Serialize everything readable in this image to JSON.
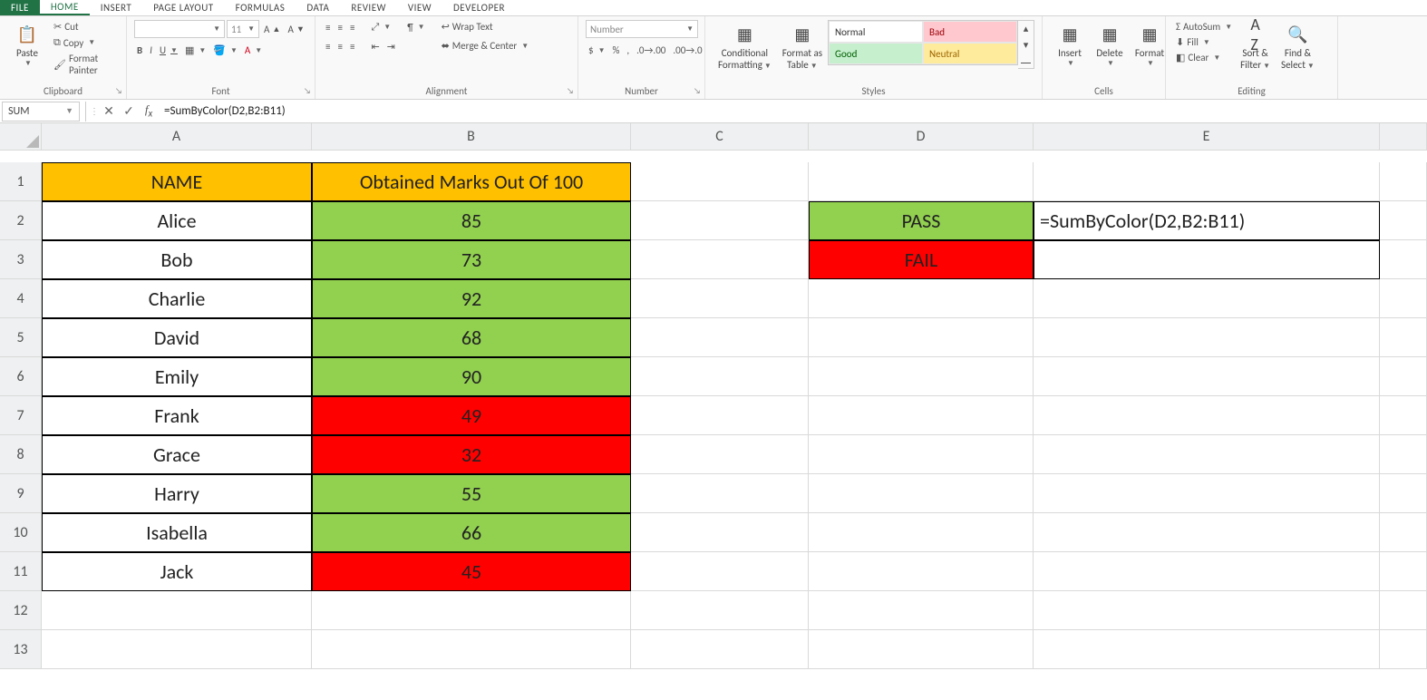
{
  "tabs": {
    "file": "FILE",
    "home": "HOME",
    "insert": "INSERT",
    "page_layout": "PAGE LAYOUT",
    "formulas": "FORMULAS",
    "data": "DATA",
    "review": "REVIEW",
    "view": "VIEW",
    "developer": "DEVELOPER"
  },
  "clipboard": {
    "paste": "Paste",
    "cut": "Cut",
    "copy": "Copy",
    "format_painter": "Format Painter",
    "label": "Clipboard"
  },
  "font": {
    "size": "11",
    "bold": "B",
    "italic": "I",
    "underline": "U",
    "label": "Font"
  },
  "alignment": {
    "wrap": "Wrap Text",
    "merge": "Merge & Center",
    "label": "Alignment"
  },
  "number": {
    "format": "Number",
    "label": "Number"
  },
  "styles": {
    "cond": "Conditional",
    "cond2": "Formatting",
    "fmt_table": "Format as",
    "fmt_table2": "Table",
    "normal": "Normal",
    "bad": "Bad",
    "good": "Good",
    "neutral": "Neutral",
    "label": "Styles"
  },
  "cells": {
    "insert": "Insert",
    "delete": "Delete",
    "format": "Format",
    "label": "Cells"
  },
  "editing": {
    "autosum": "AutoSum",
    "fill": "Fill",
    "clear": "Clear",
    "sort": "Sort &",
    "sort2": "Filter",
    "find": "Find &",
    "find2": "Select",
    "label": "Editing"
  },
  "name_box": "SUM",
  "formula": "=SumByColor(D2,B2:B11)",
  "cols": [
    "A",
    "B",
    "C",
    "D",
    "E"
  ],
  "rows": [
    "1",
    "2",
    "3",
    "4",
    "5",
    "6",
    "7",
    "8",
    "9",
    "10",
    "11",
    "12",
    "13"
  ],
  "headers": {
    "name": "NAME",
    "marks": "Obtained Marks Out Of 100"
  },
  "students": [
    {
      "name": "Alice",
      "mark": "85",
      "color": "green"
    },
    {
      "name": "Bob",
      "mark": "73",
      "color": "green"
    },
    {
      "name": "Charlie",
      "mark": "92",
      "color": "green"
    },
    {
      "name": "David",
      "mark": "68",
      "color": "green"
    },
    {
      "name": "Emily",
      "mark": "90",
      "color": "green"
    },
    {
      "name": "Frank",
      "mark": "49",
      "color": "red"
    },
    {
      "name": "Grace",
      "mark": "32",
      "color": "red"
    },
    {
      "name": "Harry",
      "mark": "55",
      "color": "green"
    },
    {
      "name": "Isabella",
      "mark": "66",
      "color": "green"
    },
    {
      "name": "Jack",
      "mark": "45",
      "color": "red"
    }
  ],
  "d2": "PASS",
  "d3": "FAIL",
  "e2": "=SumByColor(D2,B2:B11)"
}
